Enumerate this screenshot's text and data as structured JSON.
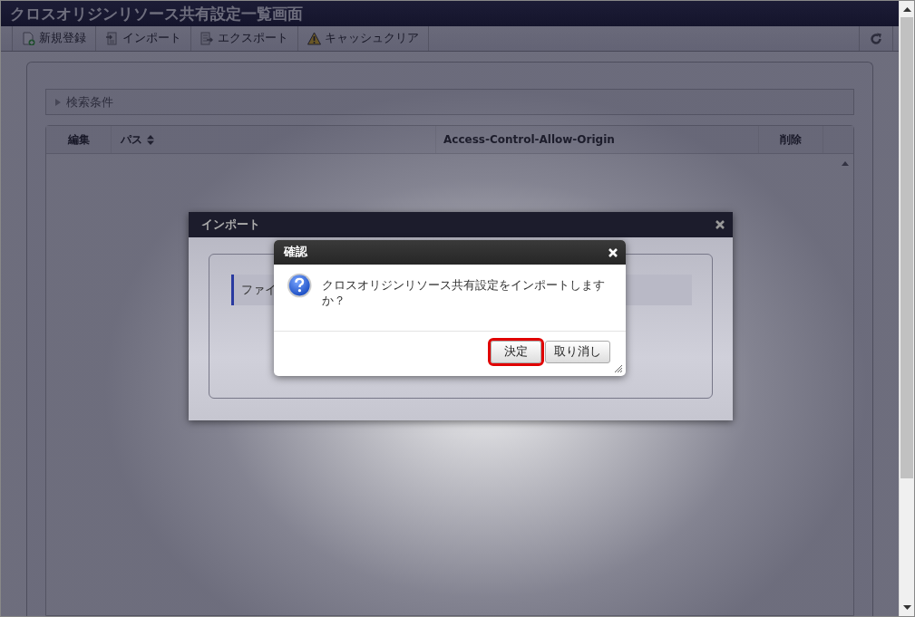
{
  "window": {
    "title": "クロスオリジンリソース共有設定一覧画面"
  },
  "toolbar": {
    "buttons": [
      {
        "label": "新規登録",
        "kind": "new"
      },
      {
        "label": "インポート",
        "kind": "import"
      },
      {
        "label": "エクスポート",
        "kind": "export"
      },
      {
        "label": "キャッシュクリア",
        "kind": "warning"
      }
    ]
  },
  "search_panel": {
    "label": "検索条件",
    "expanded": false
  },
  "table": {
    "columns": [
      {
        "label": "編集",
        "sortable": false
      },
      {
        "label": "パス",
        "sortable": true
      },
      {
        "label": "Access-Control-Allow-Origin",
        "sortable": false
      },
      {
        "label": "削除",
        "sortable": false
      }
    ]
  },
  "import_dialog": {
    "title": "インポート",
    "field_label": "ファイ"
  },
  "confirm_dialog": {
    "title": "確認",
    "message": "クロスオリジンリソース共有設定をインポートしますか？",
    "buttons": [
      {
        "label": "決定",
        "highlighted": true
      },
      {
        "label": "取り消し",
        "highlighted": false
      }
    ]
  }
}
